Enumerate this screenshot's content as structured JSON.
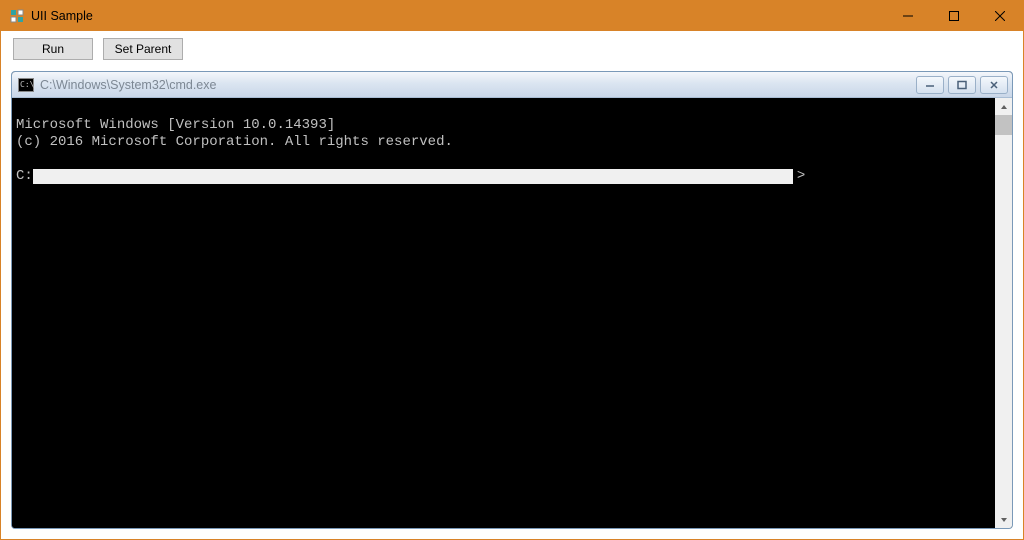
{
  "outer_window": {
    "title": "UII Sample",
    "minimize_label": "Minimize",
    "maximize_label": "Maximize",
    "close_label": "Close"
  },
  "toolbar": {
    "run_label": "Run",
    "setparent_label": "Set Parent"
  },
  "cmd_window": {
    "title": "C:\\Windows\\System32\\cmd.exe",
    "icon_text": "C:\\",
    "line1": "Microsoft Windows [Version 10.0.14393]",
    "line2": "(c) 2016 Microsoft Corporation. All rights reserved.",
    "prompt_prefix": "C:",
    "prompt_suffix": ">"
  }
}
